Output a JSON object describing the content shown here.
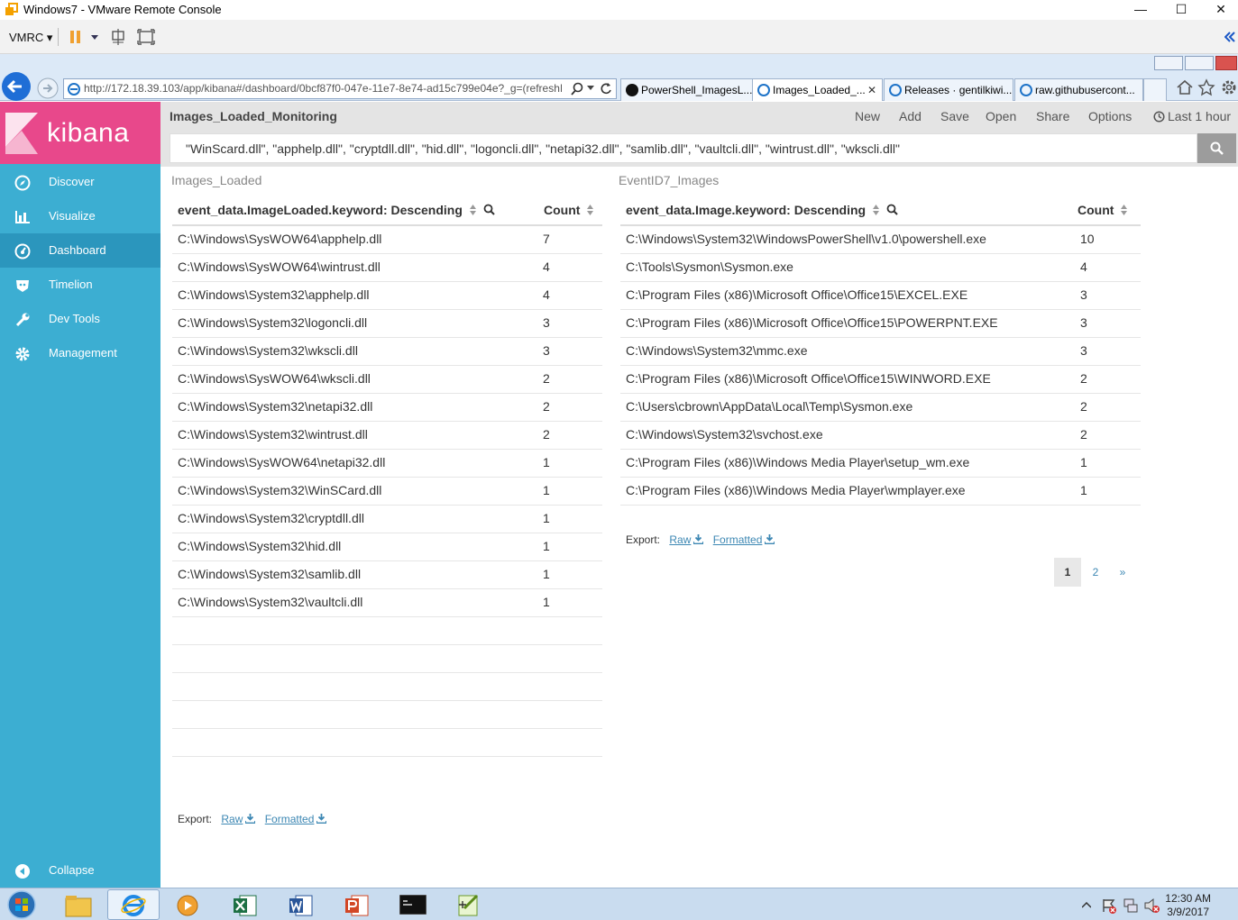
{
  "window": {
    "title": "Windows7 - VMware Remote Console",
    "minimize": "—",
    "maximize": "☐",
    "close": "✕"
  },
  "vmrc": {
    "menu_label": "VMRC ▾"
  },
  "browser": {
    "url": "http://172.18.39.103/app/kibana#/dashboard/0bcf87f0-047e-11e7-8e74-ad15c799e04e?_g=(refreshInte",
    "tabs": [
      {
        "label": "PowerShell_ImagesL..."
      },
      {
        "label": "Images_Loaded_..."
      },
      {
        "label": "Releases · gentilkiwi..."
      },
      {
        "label": "raw.githubusercont..."
      }
    ],
    "tab_close": "✕"
  },
  "sidebar": {
    "logo": "kibana",
    "items": [
      {
        "label": "Discover",
        "icon": "compass-icon"
      },
      {
        "label": "Visualize",
        "icon": "bar-chart-icon"
      },
      {
        "label": "Dashboard",
        "icon": "dashboard-icon"
      },
      {
        "label": "Timelion",
        "icon": "timelion-icon"
      },
      {
        "label": "Dev Tools",
        "icon": "wrench-icon"
      },
      {
        "label": "Management",
        "icon": "gear-icon"
      }
    ],
    "collapse_label": "Collapse"
  },
  "topbar": {
    "dashboard_title": "Images_Loaded_Monitoring",
    "menu": [
      "New",
      "Add",
      "Save",
      "Open",
      "Share",
      "Options"
    ],
    "time_picker": "Last 1 hour",
    "query": "\"WinScard.dll\", \"apphelp.dll\", \"cryptdll.dll\", \"hid.dll\", \"logoncli.dll\", \"netapi32.dll\", \"samlib.dll\", \"vaultcli.dll\", \"wintrust.dll\", \"wkscli.dll\""
  },
  "panel_left": {
    "title": "Images_Loaded",
    "col1": "event_data.ImageLoaded.keyword: Descending",
    "col2": "Count",
    "rows": [
      {
        "name": "C:\\Windows\\SysWOW64\\apphelp.dll",
        "count": "7"
      },
      {
        "name": "C:\\Windows\\SysWOW64\\wintrust.dll",
        "count": "4"
      },
      {
        "name": "C:\\Windows\\System32\\apphelp.dll",
        "count": "4"
      },
      {
        "name": "C:\\Windows\\System32\\logoncli.dll",
        "count": "3"
      },
      {
        "name": "C:\\Windows\\System32\\wkscli.dll",
        "count": "3"
      },
      {
        "name": "C:\\Windows\\SysWOW64\\wkscli.dll",
        "count": "2"
      },
      {
        "name": "C:\\Windows\\System32\\netapi32.dll",
        "count": "2"
      },
      {
        "name": "C:\\Windows\\System32\\wintrust.dll",
        "count": "2"
      },
      {
        "name": "C:\\Windows\\SysWOW64\\netapi32.dll",
        "count": "1"
      },
      {
        "name": "C:\\Windows\\System32\\WinSCard.dll",
        "count": "1"
      },
      {
        "name": "C:\\Windows\\System32\\cryptdll.dll",
        "count": "1"
      },
      {
        "name": "C:\\Windows\\System32\\hid.dll",
        "count": "1"
      },
      {
        "name": "C:\\Windows\\System32\\samlib.dll",
        "count": "1"
      },
      {
        "name": "C:\\Windows\\System32\\vaultcli.dll",
        "count": "1"
      }
    ],
    "export_label": "Export:",
    "export_raw": "Raw",
    "export_formatted": "Formatted"
  },
  "panel_right": {
    "title": "EventID7_Images",
    "col1": "event_data.Image.keyword: Descending",
    "col2": "Count",
    "rows": [
      {
        "name": "C:\\Windows\\System32\\WindowsPowerShell\\v1.0\\powershell.exe",
        "count": "10"
      },
      {
        "name": "C:\\Tools\\Sysmon\\Sysmon.exe",
        "count": "4"
      },
      {
        "name": "C:\\Program Files (x86)\\Microsoft Office\\Office15\\EXCEL.EXE",
        "count": "3"
      },
      {
        "name": "C:\\Program Files (x86)\\Microsoft Office\\Office15\\POWERPNT.EXE",
        "count": "3"
      },
      {
        "name": "C:\\Windows\\System32\\mmc.exe",
        "count": "3"
      },
      {
        "name": "C:\\Program Files (x86)\\Microsoft Office\\Office15\\WINWORD.EXE",
        "count": "2"
      },
      {
        "name": "C:\\Users\\cbrown\\AppData\\Local\\Temp\\Sysmon.exe",
        "count": "2"
      },
      {
        "name": "C:\\Windows\\System32\\svchost.exe",
        "count": "2"
      },
      {
        "name": "C:\\Program Files (x86)\\Windows Media Player\\setup_wm.exe",
        "count": "1"
      },
      {
        "name": "C:\\Program Files (x86)\\Windows Media Player\\wmplayer.exe",
        "count": "1"
      }
    ],
    "export_label": "Export:",
    "export_raw": "Raw",
    "export_formatted": "Formatted",
    "pages": [
      "1",
      "2",
      "»"
    ]
  },
  "taskbar": {
    "time": "12:30 AM",
    "date": "3/9/2017"
  },
  "colors": {
    "kibana_pink": "#e8488b",
    "sidebar_blue": "#3caed2",
    "sidebar_active": "#2b96bd",
    "link_blue": "#3c87b3"
  }
}
